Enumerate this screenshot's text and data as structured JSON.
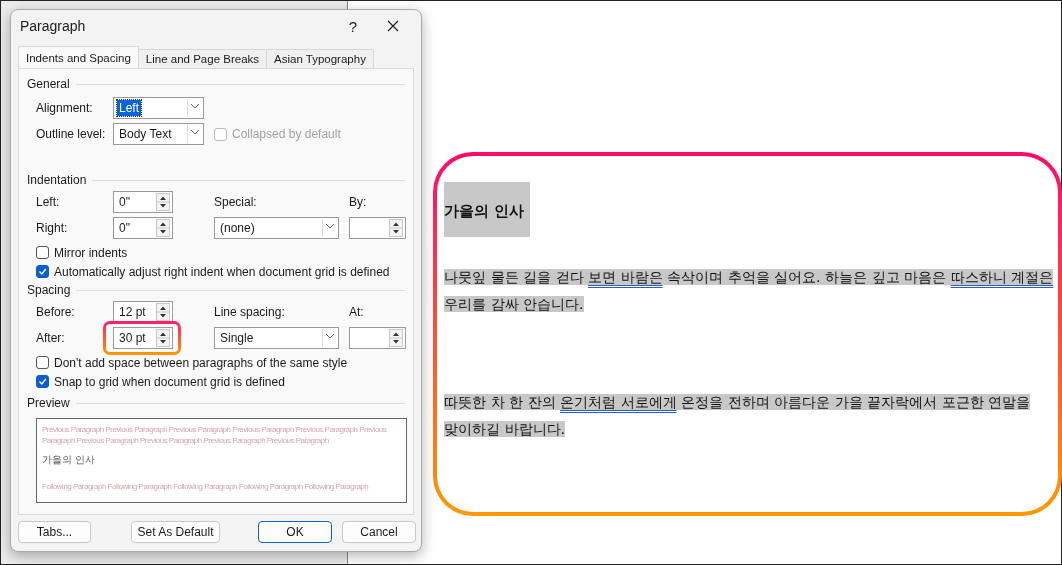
{
  "dialog": {
    "title": "Paragraph",
    "help": "?",
    "tabs": [
      {
        "label": "Indents and Spacing",
        "selected": true
      },
      {
        "label": "Line and Page Breaks",
        "selected": false
      },
      {
        "label": "Asian Typography",
        "selected": false
      }
    ],
    "general": {
      "heading": "General",
      "alignment": {
        "label": "Alignment:",
        "value": "Left",
        "focused": true
      },
      "outline_level": {
        "label": "Outline level:",
        "value": "Body Text"
      },
      "collapsed": {
        "label": "Collapsed by default",
        "checked": false,
        "disabled": true
      }
    },
    "indentation": {
      "heading": "Indentation",
      "left": {
        "label": "Left:",
        "value": "0\""
      },
      "right": {
        "label": "Right:",
        "value": "0\""
      },
      "special": {
        "label": "Special:",
        "value": "(none)"
      },
      "by": {
        "label": "By:"
      },
      "checkboxes": [
        {
          "label": "Mirror indents",
          "checked": false
        },
        {
          "label": "Automatically adjust right indent when document grid is defined",
          "checked": true
        }
      ]
    },
    "spacing": {
      "heading": "Spacing",
      "before": {
        "label": "Before:",
        "value": "12 pt"
      },
      "after": {
        "label": "After:",
        "value": "30 pt"
      },
      "line_spacing": {
        "label": "Line spacing:",
        "value": "Single"
      },
      "at": {
        "label": "At:"
      },
      "checkboxes": [
        {
          "label": "Don't add space between paragraphs of the same style",
          "checked": false
        },
        {
          "label": "Snap to grid when document grid is defined",
          "checked": true
        }
      ]
    },
    "preview": {
      "heading": "Preview",
      "previous": [
        "Previous Paragraph Previous Paragraph Previous Paragraph Previous Paragraph Previous Paragraph Previous",
        "Paragraph Previous Paragraph Previous Paragraph Previous Paragraph Previous Paragraph"
      ],
      "current": "가을의 인사",
      "following": [
        "Following Paragraph Following Paragraph Following Paragraph Following Paragraph Following Paragraph"
      ]
    },
    "buttons": [
      {
        "label": "Tabs...",
        "default": false
      },
      {
        "label": "Set As Default",
        "default": false
      },
      {
        "label": "OK",
        "default": true
      },
      {
        "label": "Cancel",
        "default": false
      }
    ]
  },
  "document": {
    "paragraphs": [
      {
        "kind": "heading",
        "segments": [
          {
            "text": "가을의 인사",
            "underlined": false
          }
        ]
      },
      {
        "kind": "body",
        "segments": [
          {
            "text": "나뭇잎 물든 길을 걷다 ",
            "underlined": false
          },
          {
            "text": "보면  바람은",
            "underlined": true
          },
          {
            "text": " 속삭이며 추억을 실어요.  하늘은 깊고 마음은 ",
            "underlined": false
          },
          {
            "text": "따스하니 계절은",
            "underlined": true
          },
          {
            "text": " 우리를 감싸 안습니다.",
            "underlined": false
          }
        ]
      },
      {
        "kind": "body",
        "segments": [
          {
            "text": "따뜻한 차 한 잔의 ",
            "underlined": false
          },
          {
            "text": "온기처럼  서로에게",
            "underlined": true
          },
          {
            "text": " 온정을 전하며  아름다운 가을 끝자락에서  포근한 연말을 맞이하길 바랍니다.",
            "underlined": false
          }
        ]
      }
    ]
  }
}
